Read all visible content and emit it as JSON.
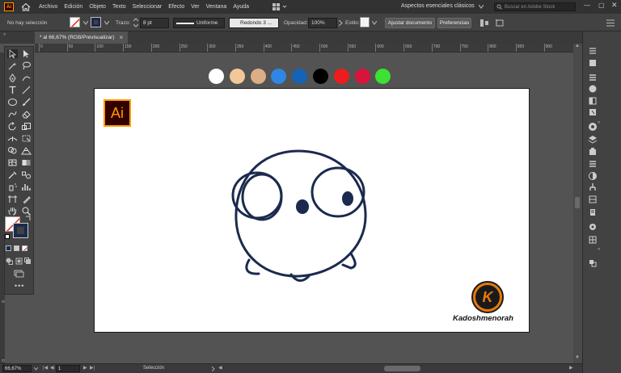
{
  "menubar": {
    "app_badge": "Ai",
    "items": [
      "Archivo",
      "Edición",
      "Objeto",
      "Texto",
      "Seleccionar",
      "Efecto",
      "Ver",
      "Ventana",
      "Ayuda"
    ],
    "workspace": "Aspectos esenciales clásicos",
    "search_placeholder": "Buscar en Adobe Stock"
  },
  "control_bar": {
    "selection_status": "No hay selección",
    "stroke_label": "Trazo:",
    "stroke_weight": "8 pt",
    "profile": "Uniforme",
    "brush": "Redondo 3 ...",
    "opacity_label": "Opacidad:",
    "opacity_value": "100%",
    "style_label": "Estilo:",
    "document_button": "Ajustar documento",
    "preferences_button": "Preferencias"
  },
  "tab": {
    "title": "* al 66,67% (RGB/Previsualizar)",
    "close": "×"
  },
  "ruler": {
    "ticks": [
      "0",
      "50",
      "100",
      "150",
      "200",
      "250",
      "300",
      "350",
      "400",
      "450",
      "500",
      "550",
      "600",
      "650",
      "700",
      "750",
      "800",
      "850",
      "900"
    ]
  },
  "swatches": [
    "#ffffff",
    "#f2c89b",
    "#dcae86",
    "#2f86e4",
    "#1463b4",
    "#000000",
    "#ee1c1c",
    "#d8143a",
    "#3ce132"
  ],
  "artboard": {
    "ai_logo_text": "Ai",
    "signature_letter": "K",
    "signature_name": "Kadoshmenorah",
    "stroke_color": "#1b2a4e"
  },
  "status_bar": {
    "zoom": "66,67%",
    "page": "1",
    "tool_name": "Selección"
  },
  "colors": {
    "accent": "#ff9a00",
    "signature_orange": "#e8780c"
  }
}
